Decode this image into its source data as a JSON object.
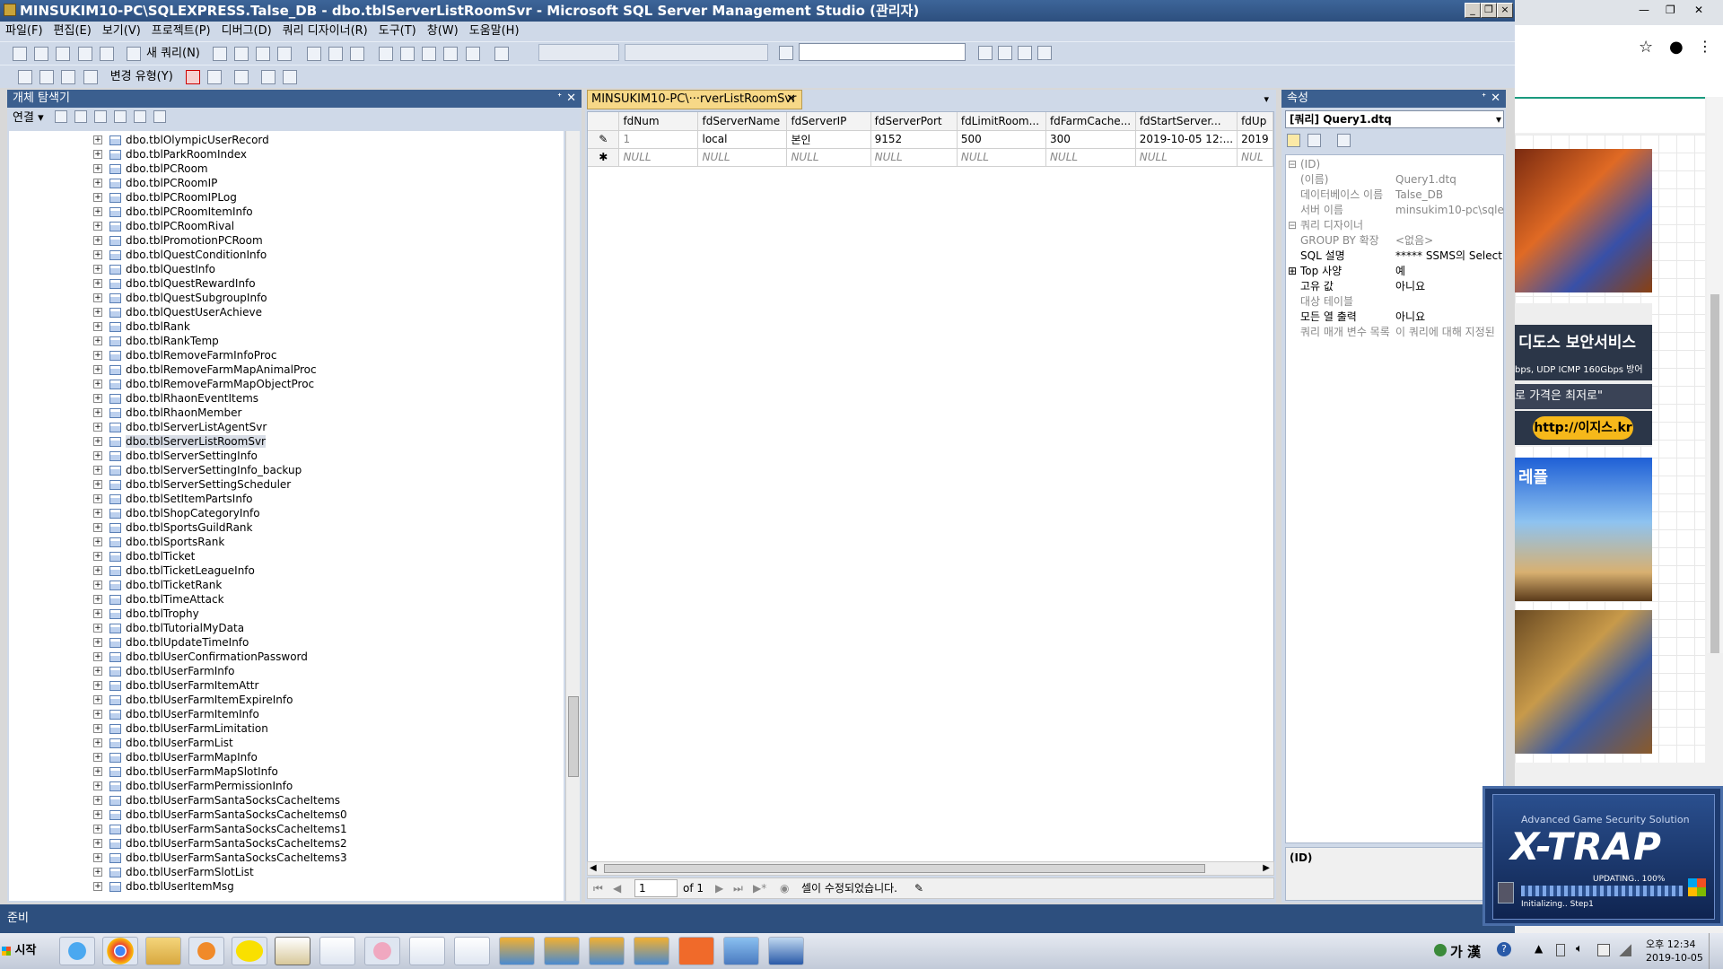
{
  "window": {
    "title": "MINSUKIM10-PC\\SQLEXPRESS.Talse_DB - dbo.tblServerListRoomSvr - Microsoft SQL Server Management Studio (관리자)"
  },
  "menu": [
    "파일(F)",
    "편집(E)",
    "보기(V)",
    "프로젝트(P)",
    "디버그(D)",
    "쿼리 디자이너(R)",
    "도구(T)",
    "창(W)",
    "도움말(H)"
  ],
  "toolbar": {
    "new_query": "새 쿼리(N)",
    "change_type": "변경 유형(Y)"
  },
  "object_explorer": {
    "title": "개체 탐색기",
    "connect": "연결",
    "items": [
      "dbo.tblOlympicUserRecord",
      "dbo.tblParkRoomIndex",
      "dbo.tblPCRoom",
      "dbo.tblPCRoomIP",
      "dbo.tblPCRoomIPLog",
      "dbo.tblPCRoomItemInfo",
      "dbo.tblPCRoomRival",
      "dbo.tblPromotionPCRoom",
      "dbo.tblQuestConditionInfo",
      "dbo.tblQuestInfo",
      "dbo.tblQuestRewardInfo",
      "dbo.tblQuestSubgroupInfo",
      "dbo.tblQuestUserAchieve",
      "dbo.tblRank",
      "dbo.tblRankTemp",
      "dbo.tblRemoveFarmInfoProc",
      "dbo.tblRemoveFarmMapAnimalProc",
      "dbo.tblRemoveFarmMapObjectProc",
      "dbo.tblRhaonEventItems",
      "dbo.tblRhaonMember",
      "dbo.tblServerListAgentSvr",
      "dbo.tblServerListRoomSvr",
      "dbo.tblServerSettingInfo",
      "dbo.tblServerSettingInfo_backup",
      "dbo.tblServerSettingScheduler",
      "dbo.tblSetItemPartsInfo",
      "dbo.tblShopCategoryInfo",
      "dbo.tblSportsGuildRank",
      "dbo.tblSportsRank",
      "dbo.tblTicket",
      "dbo.tblTicketLeagueInfo",
      "dbo.tblTicketRank",
      "dbo.tblTimeAttack",
      "dbo.tblTrophy",
      "dbo.tblTutorialMyData",
      "dbo.tblUpdateTimeInfo",
      "dbo.tblUserConfirmationPassword",
      "dbo.tblUserFarmInfo",
      "dbo.tblUserFarmItemAttr",
      "dbo.tblUserFarmItemExpireInfo",
      "dbo.tblUserFarmItemInfo",
      "dbo.tblUserFarmLimitation",
      "dbo.tblUserFarmList",
      "dbo.tblUserFarmMapInfo",
      "dbo.tblUserFarmMapSlotInfo",
      "dbo.tblUserFarmPermissionInfo",
      "dbo.tblUserFarmSantaSocksCacheItems",
      "dbo.tblUserFarmSantaSocksCacheItems0",
      "dbo.tblUserFarmSantaSocksCacheItems1",
      "dbo.tblUserFarmSantaSocksCacheItems2",
      "dbo.tblUserFarmSantaSocksCacheItems3",
      "dbo.tblUserFarmSlotList",
      "dbo.tblUserItemMsg"
    ],
    "selected_index": 21
  },
  "editor": {
    "tab_label": "MINSUKIM10-PC\\···rverListRoomSvr",
    "columns": [
      "fdNum",
      "fdServerName",
      "fdServerIP",
      "fdServerPort",
      "fdLimitRoom...",
      "fdFarmCache...",
      "fdStartServer...",
      "fdUp"
    ],
    "rows": [
      [
        "1",
        "local",
        "본인",
        "9152",
        "500",
        "300",
        "2019-10-05 12:...",
        "2019"
      ],
      [
        "NULL",
        "NULL",
        "NULL",
        "NULL",
        "NULL",
        "NULL",
        "NULL",
        "NUL"
      ]
    ],
    "page_value": "1",
    "page_of": "of 1",
    "status_msg": "셀이 수정되었습니다."
  },
  "properties": {
    "title": "속성",
    "object": "[쿼리] Query1.dtq",
    "cat_id": "(ID)",
    "cat_designer": "쿼리 디자이너",
    "rows_id": [
      {
        "k": "(이름)",
        "v": "Query1.dtq"
      },
      {
        "k": "데이터베이스 이름",
        "v": "Talse_DB"
      },
      {
        "k": "서버 이름",
        "v": "minsukim10-pc\\sqle"
      }
    ],
    "rows_designer": [
      {
        "k": "GROUP BY 확장",
        "v": "<없음>",
        "gray": true
      },
      {
        "k": "SQL 설명",
        "v": "***** SSMS의 Select"
      },
      {
        "k": "Top 사양",
        "v": "예"
      },
      {
        "k": "고유 값",
        "v": "아니요"
      },
      {
        "k": "대상 테이블",
        "v": "",
        "gray": true
      },
      {
        "k": "모든 열 출력",
        "v": "아니요"
      },
      {
        "k": "쿼리 매개 변수 목록",
        "v": "이 쿼리에 대해 지정된",
        "gray": true
      }
    ],
    "desc": "(ID)"
  },
  "status": "준비",
  "right_ads": {
    "ad1_title": "디도스 보안서비스",
    "ad1_sub": "bps, UDP ICMP 160Gbps 방어",
    "ad1_line": "로 가격은 최저로\"",
    "ad1_url": "http://이지스.kr",
    "ad2_text": "레플"
  },
  "xtrap": {
    "subtitle": "Advanced Game Security Solution",
    "logo": "X-TRAP",
    "updating": "UPDATING.. 100%",
    "init": "Initializing.. Step1"
  },
  "taskbar": {
    "start": "시작",
    "ime": "가 漢",
    "time": "오후 12:34",
    "date": "2019-10-05"
  },
  "colors": {
    "accent": "#3b5f8f",
    "tab_active": "#f7d887"
  }
}
